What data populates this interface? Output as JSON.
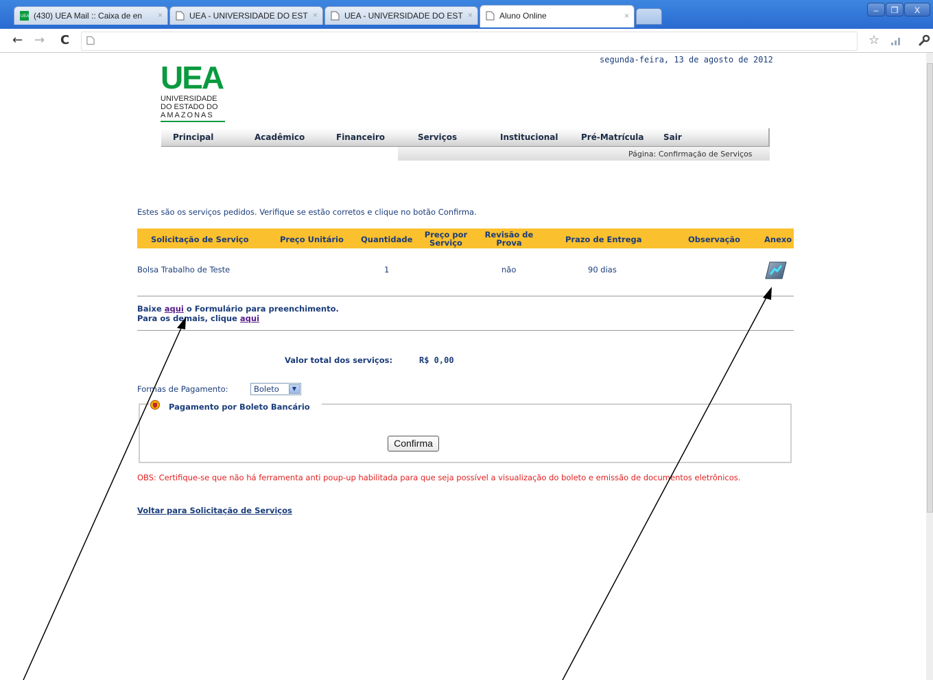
{
  "browser": {
    "tabs": [
      {
        "label": "(430) UEA Mail :: Caixa de en",
        "close": "×"
      },
      {
        "label": "UEA - UNIVERSIDADE DO EST",
        "close": "×"
      },
      {
        "label": "UEA - UNIVERSIDADE DO EST",
        "close": "×"
      },
      {
        "label": "Aluno Online",
        "close": "×"
      }
    ],
    "window_buttons": {
      "minimize": "–",
      "restore": "❐",
      "close": "X"
    }
  },
  "page": {
    "date": "segunda-feira, 13 de agosto de 2012",
    "logo": {
      "abbr": "UEA",
      "line1": "UNIVERSIDADE",
      "line2": "DO ESTADO DO",
      "line3": "AMAZONAS"
    },
    "menu": [
      "Principal",
      "Acadêmico",
      "Financeiro",
      "Serviços",
      "Institucional",
      "Pré-Matrícula",
      "Sair"
    ],
    "breadcrumb": "Página: Confirmação de Serviços",
    "intro": "Estes são os serviços pedidos. Verifique se estão corretos e clique no botão Confirma.",
    "table": {
      "headers": {
        "servico": "Solicitação de Serviço",
        "preco_unitario": "Preço Unitário",
        "quantidade": "Quantidade",
        "preco_servico_1": "Preço por",
        "preco_servico_2": "Serviço",
        "revisao_1": "Revisão de",
        "revisao_2": "Prova",
        "prazo": "Prazo de Entrega",
        "observacao": "Observação",
        "anexo": "Anexo"
      },
      "rows": [
        {
          "servico": "Bolsa Trabalho de Teste",
          "preco_unitario": "",
          "quantidade": "1",
          "preco_servico": "",
          "revisao": "não",
          "prazo": "90 dias",
          "observacao": "",
          "anexo_icon": "attachment-icon"
        }
      ]
    },
    "download": {
      "prefix": "Baixe ",
      "link": "aqui",
      "suffix": " o Formulário para preenchimento."
    },
    "others": {
      "prefix": "Para os demais, clique ",
      "link": "aqui"
    },
    "total": {
      "label": "Valor total dos serviços:",
      "value": "R$ 0,00"
    },
    "payment": {
      "label": "Formas de Pagamento:",
      "selected": "Boleto"
    },
    "boleto": {
      "legend": "Pagamento por Boleto Bancário",
      "confirm": "Confirma"
    },
    "obs": "OBS: Certifique-se que não há ferramenta anti poup-up habilitada para que seja possível a visualização do boleto e emissão de documentos eletrônicos.",
    "back": "Voltar para Solicitação de Serviços"
  },
  "colors": {
    "header_bg": "#fbc02d",
    "text": "#1a3c7a",
    "brand_green": "#0a9a3f",
    "warning": "#e02020"
  }
}
